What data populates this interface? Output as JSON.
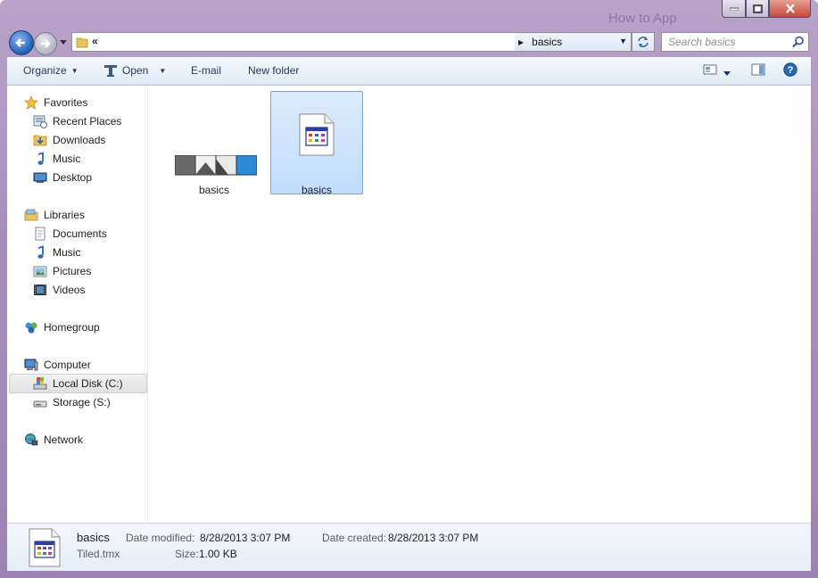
{
  "window": {
    "background_title_text": "How to App"
  },
  "navigation": {
    "address_overflow": "«",
    "breadcrumb": "basics",
    "search_placeholder": "Search basics"
  },
  "toolbar": {
    "organize": "Organize",
    "open": "Open",
    "email": "E-mail",
    "new_folder": "New folder"
  },
  "sidebar": {
    "favorites": {
      "label": "Favorites",
      "items": [
        "Recent Places",
        "Downloads",
        "Music",
        "Desktop"
      ]
    },
    "libraries": {
      "label": "Libraries",
      "items": [
        "Documents",
        "Music",
        "Pictures",
        "Videos"
      ]
    },
    "homegroup": "Homegroup",
    "computer": {
      "label": "Computer",
      "items": [
        "Local Disk (C:)",
        "Storage (S:)"
      ],
      "selected": "Local Disk (C:)"
    },
    "network": "Network"
  },
  "files": [
    {
      "name": "basics",
      "icon": "tileset-image-icon",
      "selected": false
    },
    {
      "name": "basics",
      "icon": "tmx-file-icon",
      "selected": true
    }
  ],
  "details": {
    "name": "basics",
    "type": "Tiled.tmx",
    "modified_label": "Date modified:",
    "modified_value": "8/28/2013 3:07 PM",
    "created_label": "Date created:",
    "created_value": "8/28/2013 3:07 PM",
    "size_label": "Size:",
    "size_value": "1.00 KB"
  },
  "colors": {
    "frame": "#a98ebd",
    "selection": "#c1dcfc",
    "toolbar_text": "#1e395b"
  }
}
